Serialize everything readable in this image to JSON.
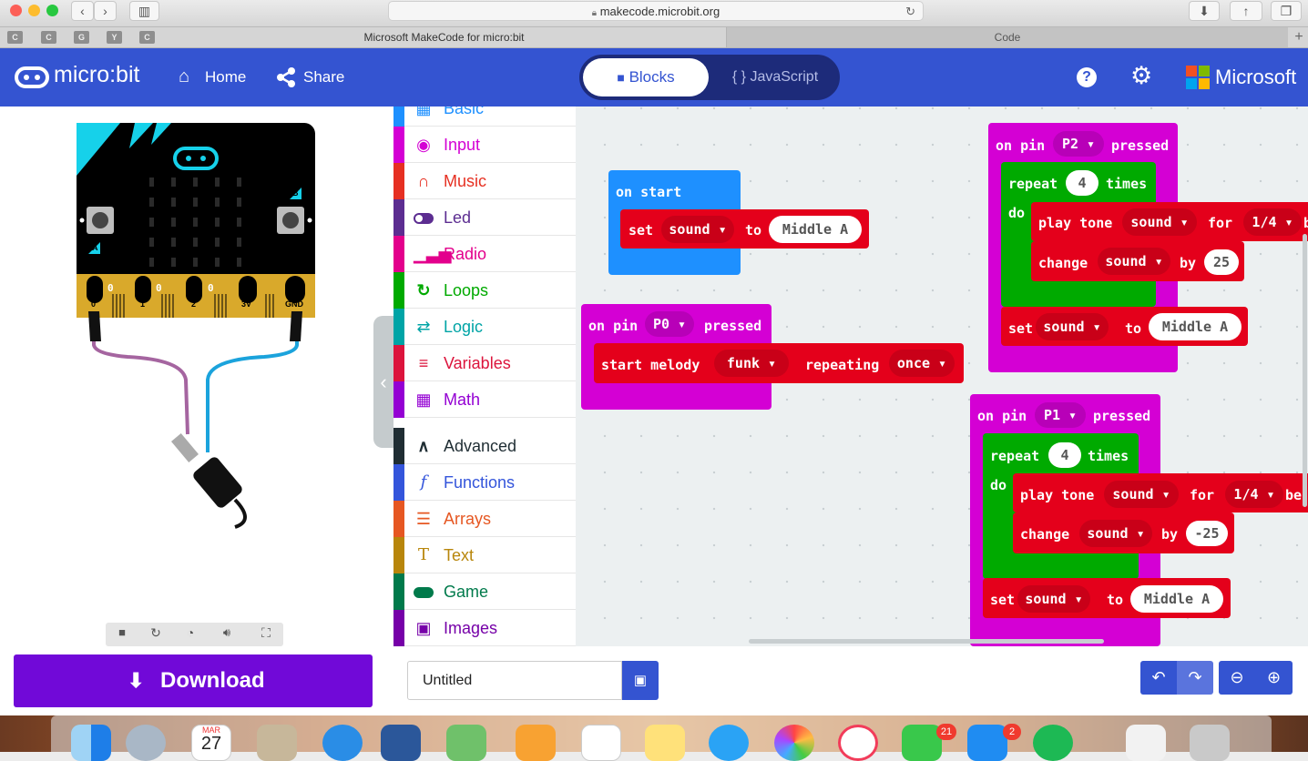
{
  "browser": {
    "url": "makecode.microbit.org",
    "tabs": [
      "Microsoft MakeCode for micro:bit",
      "Code"
    ],
    "favorites": [
      "C",
      "C",
      "G",
      "Y",
      "C"
    ]
  },
  "header": {
    "logo": "micro:bit",
    "home": "Home",
    "share": "Share",
    "mode_blocks": "Blocks",
    "mode_js": "JavaScript",
    "brand": "Microsoft"
  },
  "simulator": {
    "pins": [
      "0",
      "1",
      "2",
      "3V",
      "GND"
    ],
    "pin_values": [
      "0",
      "0",
      "0"
    ],
    "button_a": "A",
    "button_b": "B"
  },
  "toolbox": {
    "categories": [
      {
        "label": "Basic",
        "color": "#1e90ff",
        "icon": "grid-icon"
      },
      {
        "label": "Input",
        "color": "#d400d4",
        "icon": "target-icon"
      },
      {
        "label": "Music",
        "color": "#e63022",
        "icon": "headphones-icon"
      },
      {
        "label": "Led",
        "color": "#5c2d91",
        "icon": "toggle-icon"
      },
      {
        "label": "Radio",
        "color": "#e3008c",
        "icon": "signal-icon"
      },
      {
        "label": "Loops",
        "color": "#00aa00",
        "icon": "refresh-icon"
      },
      {
        "label": "Logic",
        "color": "#00a4a6",
        "icon": "shuffle-icon"
      },
      {
        "label": "Variables",
        "color": "#dc143c",
        "icon": "list-icon"
      },
      {
        "label": "Math",
        "color": "#9400d3",
        "icon": "calculator-icon"
      },
      {
        "label": "Advanced",
        "color": "#1f2d33",
        "icon": "chevron-up-icon"
      },
      {
        "label": "Functions",
        "color": "#3455db",
        "icon": "function-icon"
      },
      {
        "label": "Arrays",
        "color": "#e65722",
        "icon": "array-icon"
      },
      {
        "label": "Text",
        "color": "#b8860b",
        "icon": "text-icon"
      },
      {
        "label": "Game",
        "color": "#007a4b",
        "icon": "gamepad-icon"
      },
      {
        "label": "Images",
        "color": "#7600a8",
        "icon": "image-icon"
      }
    ]
  },
  "blocks": {
    "on_start": {
      "header": "on start",
      "set": "set",
      "var": "sound",
      "to": "to",
      "value": "Middle A"
    },
    "pin_p0": {
      "on_pin": "on pin",
      "pin": "P0",
      "pressed": "pressed",
      "start_melody": "start melody",
      "melody": "funk",
      "repeating": "repeating",
      "once": "once"
    },
    "pin_p2": {
      "on_pin": "on pin",
      "pin": "P2",
      "pressed": "pressed",
      "repeat": "repeat",
      "times_value": "4",
      "times": "times",
      "do": "do",
      "play_tone": "play tone",
      "tone_var": "sound",
      "for": "for",
      "beat": "1/4",
      "beat_suffix": "b",
      "change": "change",
      "change_var": "sound",
      "by": "by",
      "by_value": "25",
      "set": "set",
      "set_var": "sound",
      "to": "to",
      "set_value": "Middle A"
    },
    "pin_p1": {
      "on_pin": "on pin",
      "pin": "P1",
      "pressed": "pressed",
      "repeat": "repeat",
      "times_value": "4",
      "times": "times",
      "do": "do",
      "play_tone": "play tone",
      "tone_var": "sound",
      "for": "for",
      "beat": "1/4",
      "beat_suffix": "be",
      "change": "change",
      "change_var": "sound",
      "by": "by",
      "by_value": "-25",
      "set": "set",
      "set_var": "sound",
      "to": "to",
      "set_value": "Middle A"
    }
  },
  "footer": {
    "download": "Download",
    "project_name": "Untitled"
  },
  "dock": {
    "calendar_month": "MAR",
    "calendar_day": "27",
    "facetime_badge": "21",
    "appstore_badge": "2"
  }
}
